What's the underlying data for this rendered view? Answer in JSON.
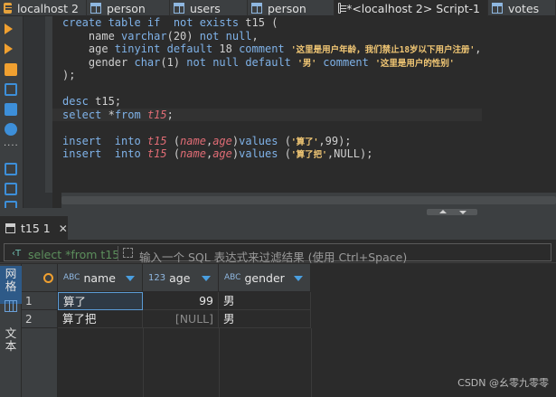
{
  "tabs": [
    {
      "label": "localhost 2",
      "icon": "database-icon"
    },
    {
      "label": "person",
      "icon": "table-icon"
    },
    {
      "label": "users",
      "icon": "table-icon"
    },
    {
      "label": "person",
      "icon": "table-icon"
    },
    {
      "label": "*<localhost 2> Script-1",
      "icon": "script-icon"
    },
    {
      "label": "votes",
      "icon": "table-icon"
    }
  ],
  "editor": {
    "line1": {
      "kw1": "create table if  not exists ",
      "name": "t15",
      "rest": " ("
    },
    "line2": {
      "a": "    name ",
      "kw": "varchar",
      "b": "(20) ",
      "kw2": "not null",
      "c": ","
    },
    "line3": {
      "a": "    age ",
      "kw": "tinyint default ",
      "n": "18",
      "kw2": " comment ",
      "s": "'这里是用户年龄，我们禁止18岁以下用户注册'",
      "c": ","
    },
    "line4": {
      "a": "    gender ",
      "kw": "char",
      "b": "(1) ",
      "kw2": "not null default ",
      "s": "'男'",
      "kw3": " comment ",
      "s2": "'这里是用户的性别'"
    },
    "line5": ");",
    "line7": {
      "kw": "desc ",
      "name": "t15",
      "c": ";"
    },
    "line8": {
      "kw": "select ",
      "a": "*",
      "kw2": "from ",
      "name": "t15",
      "c": ";"
    },
    "line10": {
      "kw": "insert  into ",
      "name": "t15",
      "a": " (",
      "c1": "name",
      "b": ",",
      "c2": "age",
      "d": ")",
      "kw2": "values",
      "e": " (",
      "s": "'算了'",
      "f": ",99);"
    },
    "line11": {
      "kw": "insert  into ",
      "name": "t15",
      "a": " (",
      "c1": "name",
      "b": ",",
      "c2": "age",
      "d": ")",
      "kw2": "values",
      "e": " (",
      "s": "'算了把'",
      "f": ",NULL);"
    }
  },
  "result_tab": {
    "label": "t15 1"
  },
  "filter": {
    "value": "select *from t15",
    "placeholder": "输入一个 SQL 表达式来过滤结果 (使用 Ctrl+Space)"
  },
  "side_panel": {
    "grid_label": "网格",
    "text_label": "文本"
  },
  "grid": {
    "columns": [
      {
        "name": "name",
        "type_badge": "ABC"
      },
      {
        "name": "age",
        "type_badge": "123"
      },
      {
        "name": "gender",
        "type_badge": "ABC"
      }
    ],
    "rows": [
      {
        "num": "1",
        "name": "算了",
        "age": "99",
        "gender": "男"
      },
      {
        "num": "2",
        "name": "算了把",
        "age": "[NULL]",
        "gender": "男"
      }
    ]
  },
  "watermark": "CSDN @幺零九零零",
  "colors": {
    "keyword": "#7fb2e8",
    "table_name": "#e06c75",
    "string": "#f0c674",
    "accent": "#f0a030"
  }
}
